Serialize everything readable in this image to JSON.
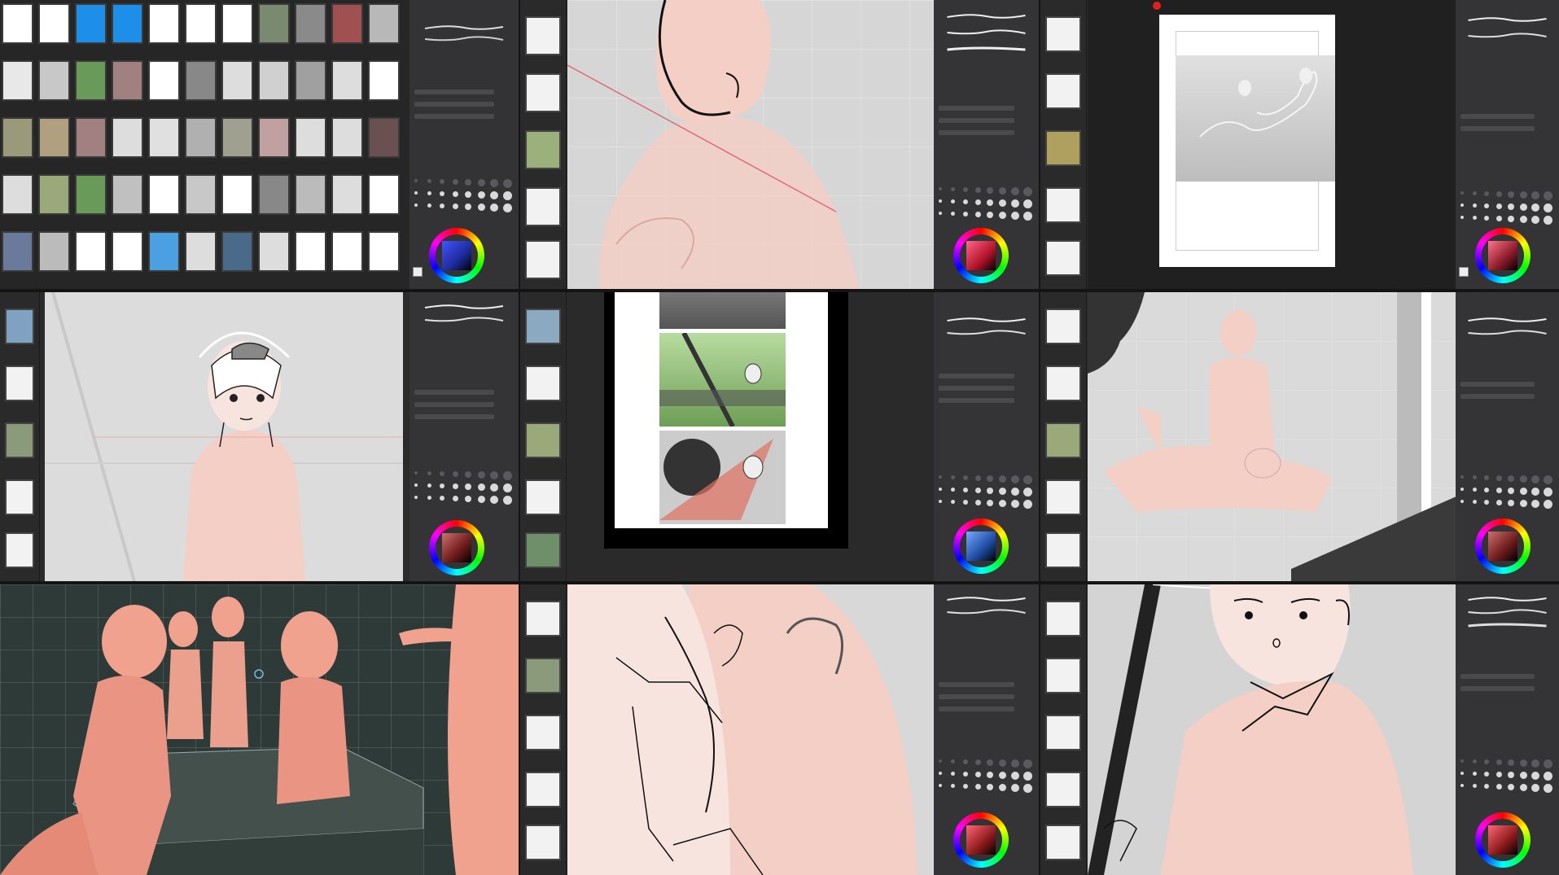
{
  "grid": {
    "rows": 3,
    "cols": 3
  },
  "icons": {
    "brush_stroke": "brush-stroke-icon",
    "color_wheel": "color-wheel-icon",
    "page_thumb": "page-thumbnail-icon",
    "pen_marker": "red-pen-marker-icon"
  },
  "colors": {
    "ui_dark": "#2b2b2b",
    "panel": "#333335",
    "canvas_gray": "#dcdcdc",
    "figure_pink": "#f3cfc6",
    "model_salmon": "#f0a28f",
    "accent_blue": "#1e8fe8",
    "wheel_color_blue": "#1d2a9a",
    "wheel_color_red": "#b2132a",
    "wheel_color_maroon": "#6b1a1a"
  },
  "tiles": [
    {
      "id": "tile-1",
      "content": "page-manager",
      "color_sample": "#1d2a9a"
    },
    {
      "id": "tile-2",
      "content": "figure-head-sketch",
      "color_sample": "#b2132a"
    },
    {
      "id": "tile-3",
      "content": "page-preview",
      "color_sample": "#8a1a2a"
    },
    {
      "id": "tile-4",
      "content": "character-sketch",
      "color_sample": "#6b1a1a"
    },
    {
      "id": "tile-5",
      "content": "manga-page-panels",
      "color_sample": "#1d4aa0"
    },
    {
      "id": "tile-6",
      "content": "posed-figures",
      "color_sample": "#6b1a1a"
    },
    {
      "id": "tile-7",
      "content": "3d-models-scene",
      "color_sample": ""
    },
    {
      "id": "tile-8",
      "content": "figure-closeup-lineart",
      "color_sample": "#8a1a1a"
    },
    {
      "id": "tile-9",
      "content": "character-bust-lineart",
      "color_sample": "#8a1a1a"
    }
  ]
}
